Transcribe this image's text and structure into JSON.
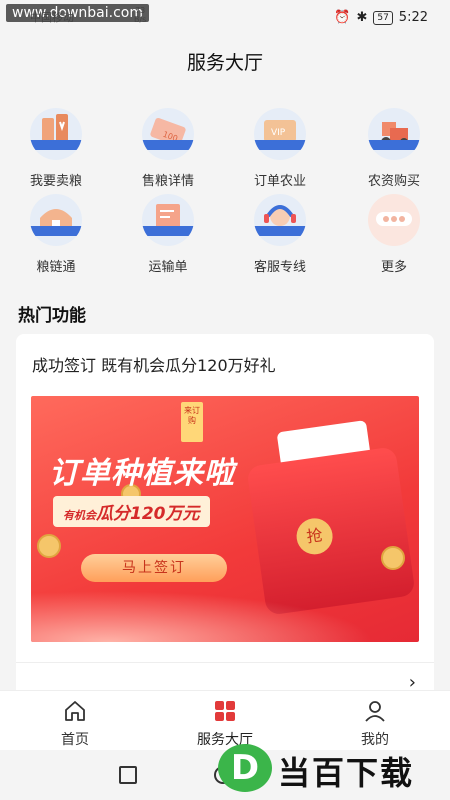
{
  "status_bar": {
    "watermark": "www.downbai.com",
    "carrier": "中国移动",
    "speed_value": "73",
    "speed_unit": "B/s",
    "battery": "57",
    "time": "5:22"
  },
  "header": {
    "title": "服务大厅"
  },
  "services": [
    {
      "label": "我要卖粮",
      "icon": "grain-silo-icon"
    },
    {
      "label": "售粮详情",
      "icon": "ticket-icon"
    },
    {
      "label": "订单农业",
      "icon": "vip-card-icon"
    },
    {
      "label": "农资购买",
      "icon": "tractor-icon"
    },
    {
      "label": "粮链通",
      "icon": "warehouse-icon"
    },
    {
      "label": "运输单",
      "icon": "document-icon"
    },
    {
      "label": "客服专线",
      "icon": "customer-service-icon"
    },
    {
      "label": "更多",
      "icon": "more-icon"
    }
  ],
  "hot": {
    "section_title": "热门功能",
    "card_title": "成功签订 既有机会瓜分120万好礼",
    "banner": {
      "tag": "来订购",
      "heading": "订单种植来啦",
      "sub_prefix": "有机会",
      "sub_main": "瓜分120万元",
      "button": "马上签订",
      "envelope_char": "抢"
    }
  },
  "tabbar": {
    "tabs": [
      {
        "label": "首页",
        "icon": "home-icon"
      },
      {
        "label": "服务大厅",
        "icon": "grid-icon",
        "active": true
      },
      {
        "label": "我的",
        "icon": "user-icon"
      }
    ]
  },
  "watermark_logo": {
    "letter": "D",
    "text": "当百下载"
  },
  "colors": {
    "accent": "#e23a3a",
    "icon_blue": "#3c6fd8",
    "icon_bg": "#e6edf7"
  }
}
